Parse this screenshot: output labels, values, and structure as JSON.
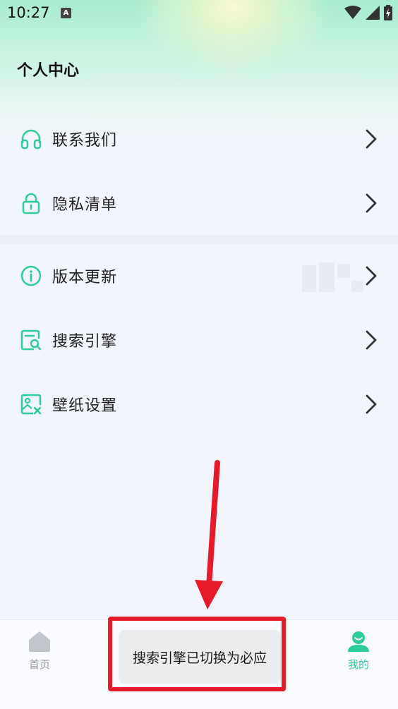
{
  "status_bar": {
    "time": "10:27",
    "app_badge": "A"
  },
  "header": {
    "title": "个人中心"
  },
  "menu_group_1": [
    {
      "label": "联系我们",
      "icon": "headphones-icon"
    },
    {
      "label": "隐私清单",
      "icon": "lock-icon"
    }
  ],
  "menu_group_2": [
    {
      "label": "版本更新",
      "icon": "info-icon"
    },
    {
      "label": "搜索引擎",
      "icon": "search-doc-icon"
    },
    {
      "label": "壁纸设置",
      "icon": "wallpaper-icon"
    }
  ],
  "bottom_nav": [
    {
      "label": "首页",
      "icon": "home-icon",
      "active": false
    },
    {
      "label": "我的",
      "icon": "profile-icon",
      "active": true
    }
  ],
  "toast": {
    "message": "搜索引擎已切换为必应"
  },
  "colors": {
    "accent": "#2ecc9a",
    "annotation_red": "#e51a2a",
    "inactive": "#9a9ca6"
  }
}
